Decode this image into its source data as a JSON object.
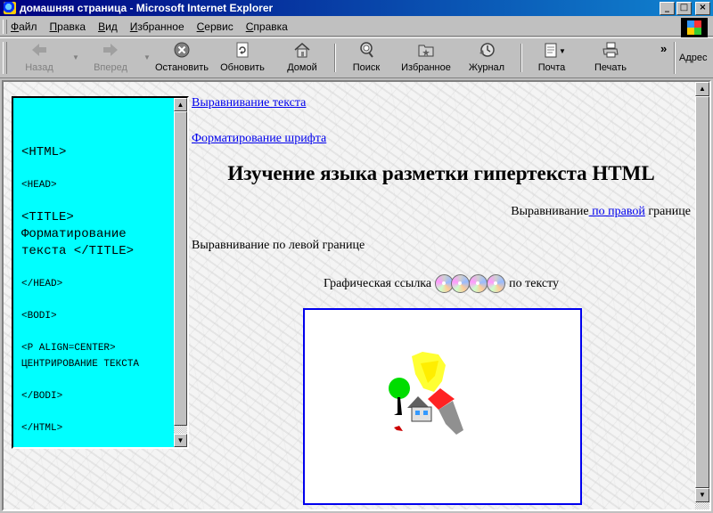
{
  "window": {
    "title": "домашняя страница - Microsoft Internet Explorer"
  },
  "menu": {
    "items": [
      "Файл",
      "Правка",
      "Вид",
      "Избранное",
      "Сервис",
      "Справка"
    ]
  },
  "toolbar": {
    "back": "Назад",
    "forward": "Вперед",
    "stop": "Остановить",
    "refresh": "Обновить",
    "home": "Домой",
    "search": "Поиск",
    "favorites": "Избранное",
    "history": "Журнал",
    "mail": "Почта",
    "print": "Печать",
    "address_label": "Адрес"
  },
  "left_frame": {
    "lines": [
      "<HTML>",
      "<HEAD>",
      "<TITLE> Форматирование текста </TITLE>",
      "</HEAD>",
      "<BODI>",
      "<P ALIGN=CENTER> ЦЕНТРИРОВАНИЕ ТЕКСТА",
      "</BODI>",
      "</HTML>"
    ]
  },
  "main": {
    "link1": "Выравнивание текста",
    "link2": "Форматирование шрифта",
    "heading": "Изучение языка разметки гипертекста HTML",
    "right_prefix": "Выравнивание",
    "right_link": " по правой",
    "right_suffix": " границе",
    "left_line": "Выравнивание по левой границе",
    "center_prefix": "Графическая ссылка ",
    "center_suffix": " по тексту"
  }
}
